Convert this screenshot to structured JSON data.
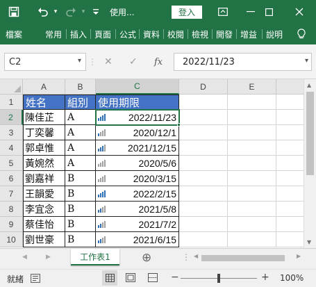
{
  "title_bar": {
    "save_icon": "save-icon",
    "undo_icon": "undo-icon",
    "redo_icon": "redo-icon",
    "customize_icon": "customize-qat-icon",
    "file_title": "使用...",
    "login_label": "登入",
    "ribbon_display_icon": "ribbon-display-icon",
    "minimize_icon": "minimize-icon",
    "maximize_icon": "maximize-icon",
    "close_icon": "close-icon",
    "brand_color": "#217346"
  },
  "ribbon": {
    "tabs": [
      "檔案",
      "常用",
      "插入",
      "頁面",
      "公式",
      "資料",
      "校閱",
      "檢視",
      "開發",
      "增益",
      "說明"
    ],
    "lightbulb_icon": "lightbulb-icon"
  },
  "formula_bar": {
    "name_box": "C2",
    "cancel_icon": "✕",
    "enter_icon": "✓",
    "fx_label": "fx",
    "formula_value": "2022/11/23"
  },
  "grid": {
    "column_headers": [
      "A",
      "B",
      "C",
      "D",
      "E"
    ],
    "row_headers": [
      "1",
      "2",
      "3",
      "4",
      "5",
      "6",
      "7",
      "8",
      "9",
      "10"
    ],
    "header_row": [
      "姓名",
      "組別",
      "使用期限"
    ],
    "rows": [
      {
        "name": "陳佳芷",
        "group": "A",
        "date": "2022/11/23",
        "level": 4
      },
      {
        "name": "丁奕馨",
        "group": "A",
        "date": "2020/12/1",
        "level": 1
      },
      {
        "name": "郭卓惟",
        "group": "A",
        "date": "2021/12/15",
        "level": 3
      },
      {
        "name": "黃婉然",
        "group": "A",
        "date": "2020/5/6",
        "level": 0
      },
      {
        "name": "劉嘉祥",
        "group": "B",
        "date": "2020/3/15",
        "level": 0
      },
      {
        "name": "王韻愛",
        "group": "B",
        "date": "2022/2/15",
        "level": 4
      },
      {
        "name": "李宜念",
        "group": "B",
        "date": "2021/5/8",
        "level": 2
      },
      {
        "name": "蔡佳怡",
        "group": "B",
        "date": "2021/7/2",
        "level": 2
      },
      {
        "name": "劉世豪",
        "group": "B",
        "date": "2021/6/15",
        "level": 2
      }
    ],
    "header_fill": "#4472c4",
    "icon_active_color": "#2f6fb5",
    "icon_inactive_color": "#a0a0a0"
  },
  "sheet_bar": {
    "prev_icon": "◀",
    "next_icon": "▶",
    "sheet_tab": "工作表1",
    "add_sheet_icon": "⊕",
    "more_icon": "⋮"
  },
  "status_bar": {
    "ready": "就緒",
    "view_normal_icon": "normal-view-icon",
    "view_layout_icon": "page-layout-icon",
    "view_break_icon": "page-break-icon",
    "zoom_out": "−",
    "zoom_in": "+",
    "zoom": "100%"
  }
}
